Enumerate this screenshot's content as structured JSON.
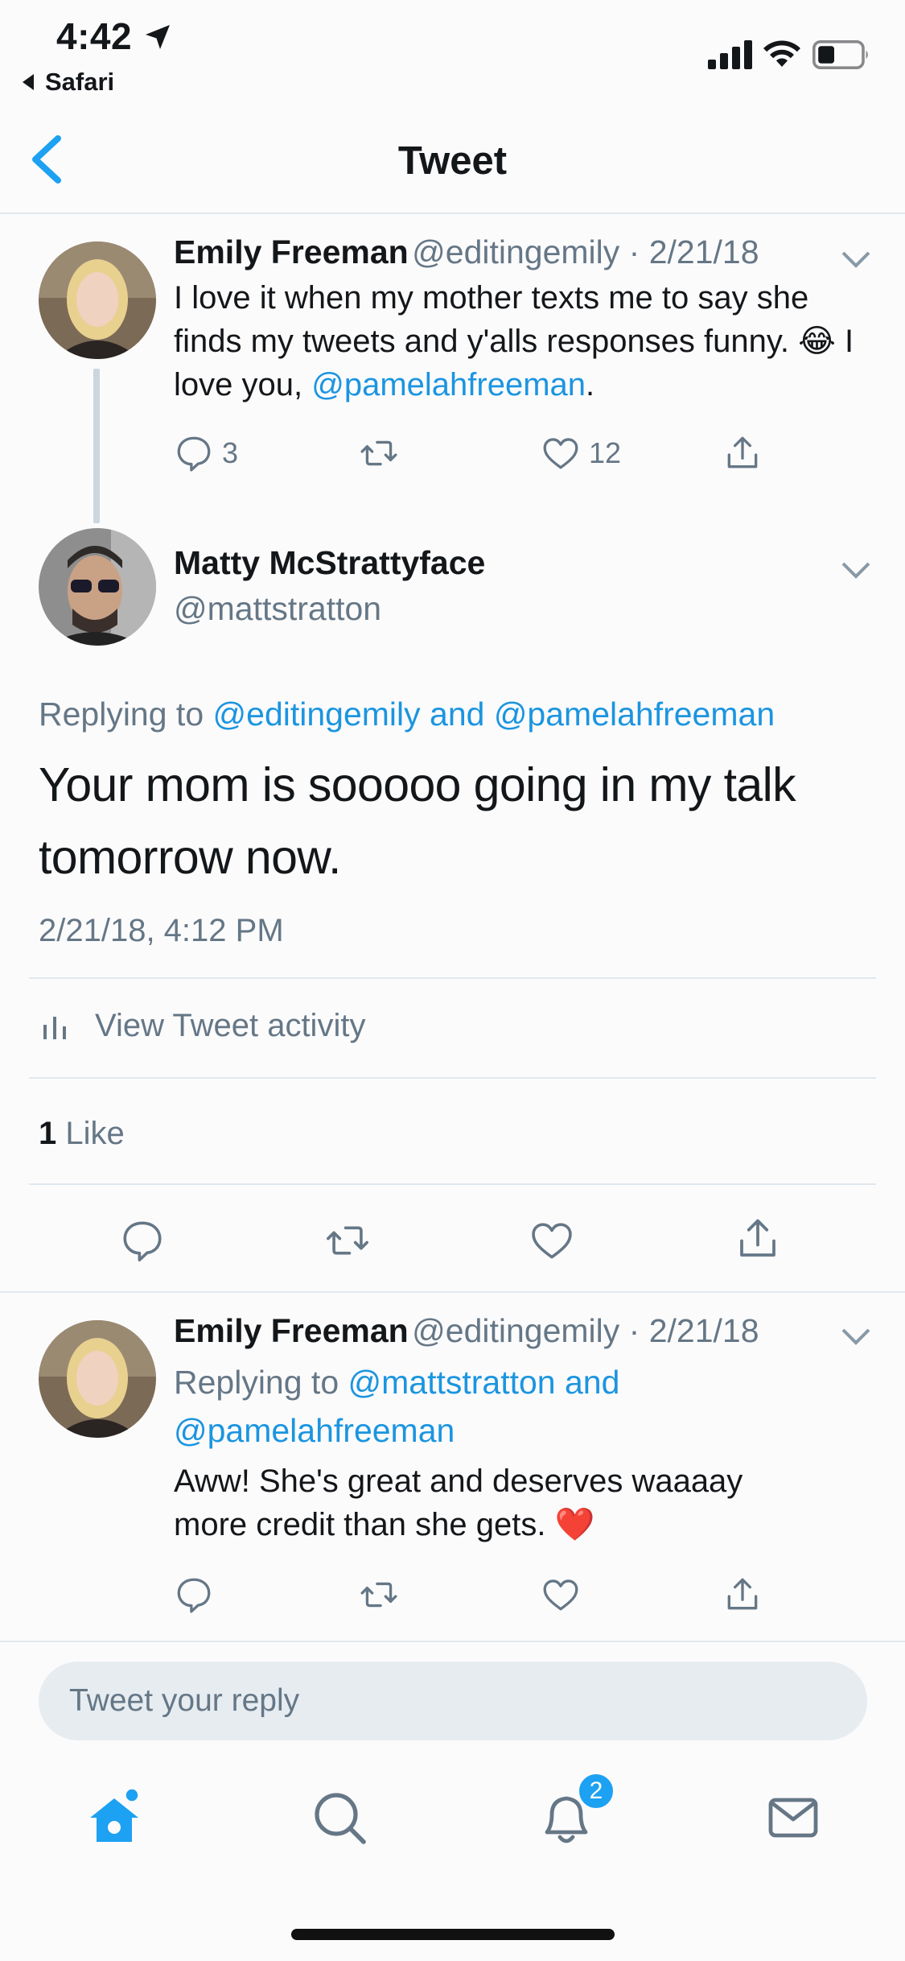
{
  "status_bar": {
    "time": "4:42",
    "back_app": "Safari"
  },
  "nav": {
    "title": "Tweet"
  },
  "tweet1": {
    "name": "Emily Freeman",
    "handle": "@editingemily",
    "date": "2/21/18",
    "text_part1": "I love it when my mother texts me to say she finds my tweets and y'alls responses funny.",
    "emoji": "😂",
    "text_part2": " I love you, ",
    "mention": "@pamelahfreeman",
    "text_end": ".",
    "replies": "3",
    "likes": "12"
  },
  "main_tweet": {
    "name": "Matty McStrattyface",
    "handle": "@mattstratton",
    "replying_prefix": "Replying to ",
    "replying_to": "@editingemily and @pamelahfreeman",
    "text": "Your mom is sooooo going in my talk tomorrow now.",
    "timestamp": "2/21/18, 4:12 PM",
    "activity_label": "View Tweet activity",
    "like_count": "1",
    "like_label": " Like"
  },
  "tweet3": {
    "name": "Emily Freeman",
    "handle": "@editingemily",
    "date": "2/21/18",
    "replying_prefix": "Replying to ",
    "replying_to": "@mattstratton and @pamelahfreeman",
    "text": "Aww! She's great and deserves waaaay more credit than she gets. ",
    "emoji": "❤️"
  },
  "reply_bar": {
    "placeholder": "Tweet your reply"
  },
  "tabbar": {
    "notifications_badge": "2"
  },
  "colors": {
    "accent": "#1da1f2",
    "link": "#1b95e0",
    "muted": "#657786",
    "divider": "#e1e8ed"
  },
  "icons": [
    "location-arrow-icon",
    "signal-icon",
    "wifi-icon",
    "battery-icon",
    "back-chevron-icon",
    "chevron-down-icon",
    "reply-icon",
    "retweet-icon",
    "like-icon",
    "share-icon",
    "activity-icon",
    "home-icon",
    "search-icon",
    "bell-icon",
    "mail-icon"
  ]
}
